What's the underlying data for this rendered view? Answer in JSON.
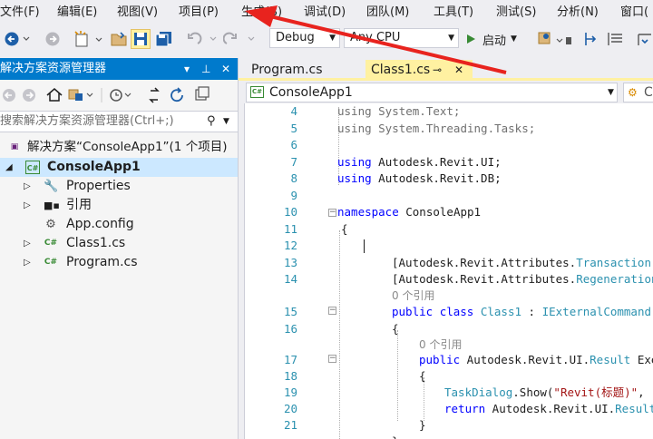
{
  "menu": [
    "文件(F)",
    "编辑(E)",
    "视图(V)",
    "项目(P)",
    "生成(B)",
    "调试(D)",
    "团队(M)",
    "工具(T)",
    "测试(S)",
    "分析(N)",
    "窗口("
  ],
  "toolbar": {
    "config": "Debug",
    "platform": "Any CPU",
    "start_label": "启动"
  },
  "solution_explorer": {
    "title": "解决方案资源管理器",
    "pin_glyph": "▾ ╫ ✕",
    "search_placeholder": "搜索解决方案资源管理器(Ctrl+;)",
    "items": [
      {
        "label": "解决方案“ConsoleApp1”(1 个项目)",
        "icon": "solution-icon"
      },
      {
        "label": "ConsoleApp1",
        "icon": "csharp-project-icon"
      },
      {
        "label": "Properties",
        "icon": "wrench-icon"
      },
      {
        "label": "引用",
        "icon": "references-icon"
      },
      {
        "label": "App.config",
        "icon": "config-file-icon"
      },
      {
        "label": "Class1.cs",
        "icon": "csharp-file-icon"
      },
      {
        "label": "Program.cs",
        "icon": "csharp-file-icon"
      }
    ]
  },
  "tabs": [
    {
      "label": "Program.cs",
      "active": false
    },
    {
      "label": "Class1.cs",
      "active": true
    }
  ],
  "tab_pin": "⊸",
  "tab_close": "✕",
  "navbar": {
    "project": "ConsoleApp1",
    "type_prefix": "C"
  },
  "code": {
    "lines": [
      {
        "n": "4",
        "parts": [
          [
            "gr",
            "using System.Text;"
          ]
        ]
      },
      {
        "n": "5",
        "parts": [
          [
            "gr",
            "using System.Threading.Tasks;"
          ]
        ]
      },
      {
        "n": "6",
        "parts": []
      },
      {
        "n": "7",
        "parts": [
          [
            "kw",
            "using"
          ],
          [
            "",
            " Autodesk.Revit.UI;"
          ]
        ]
      },
      {
        "n": "8",
        "parts": [
          [
            "kw",
            "using"
          ],
          [
            "",
            " Autodesk.Revit.DB;"
          ]
        ]
      },
      {
        "n": "9",
        "parts": []
      },
      {
        "n": "10",
        "parts": [
          [
            "kw",
            "namespace"
          ],
          [
            "",
            " ConsoleApp1"
          ]
        ]
      },
      {
        "n": "11",
        "parts": [
          [
            "",
            "{"
          ]
        ]
      },
      {
        "n": "12",
        "parts": []
      },
      {
        "n": "13",
        "parts": [
          [
            "",
            "[Autodesk.Revit.Attributes."
          ],
          [
            "ty",
            "Transaction"
          ],
          [
            "",
            "("
          ]
        ]
      },
      {
        "n": "14",
        "parts": [
          [
            "",
            "[Autodesk.Revit.Attributes."
          ],
          [
            "ty",
            "Regeneration"
          ]
        ]
      },
      {
        "n": "15",
        "parts": [
          [
            "kw",
            "public"
          ],
          [
            "",
            " "
          ],
          [
            "kw",
            "class"
          ],
          [
            "",
            " "
          ],
          [
            "ty",
            "Class1"
          ],
          [
            "",
            " : "
          ],
          [
            "ty",
            "IExternalCommand"
          ]
        ]
      },
      {
        "n": "16",
        "parts": [
          [
            "",
            "{"
          ]
        ]
      },
      {
        "n": "17",
        "parts": [
          [
            "kw",
            "public"
          ],
          [
            "",
            " Autodesk.Revit.UI."
          ],
          [
            "ty",
            "Result"
          ],
          [
            "",
            " Exe"
          ]
        ]
      },
      {
        "n": "18",
        "parts": [
          [
            "",
            "{"
          ]
        ]
      },
      {
        "n": "19",
        "parts": [
          [
            "ty",
            "TaskDialog"
          ],
          [
            "",
            ".Show("
          ],
          [
            "st",
            "\"Revit(标题)\""
          ],
          [
            "",
            ","
          ]
        ]
      },
      {
        "n": "20",
        "parts": [
          [
            "kw",
            "return"
          ],
          [
            "",
            " Autodesk.Revit.UI."
          ],
          [
            "ty",
            "Result"
          ]
        ]
      },
      {
        "n": "21",
        "parts": [
          [
            "",
            "}"
          ]
        ]
      },
      {
        "n": "",
        "parts": [
          [
            "",
            "}"
          ]
        ]
      }
    ],
    "ref_hint": "0 个引用"
  },
  "colors": {
    "accent": "#007acc",
    "active_tab": "#fff1a1",
    "keyword": "#0000ff",
    "type": "#2b91af",
    "string": "#a31515",
    "arrow": "#e8231e"
  }
}
